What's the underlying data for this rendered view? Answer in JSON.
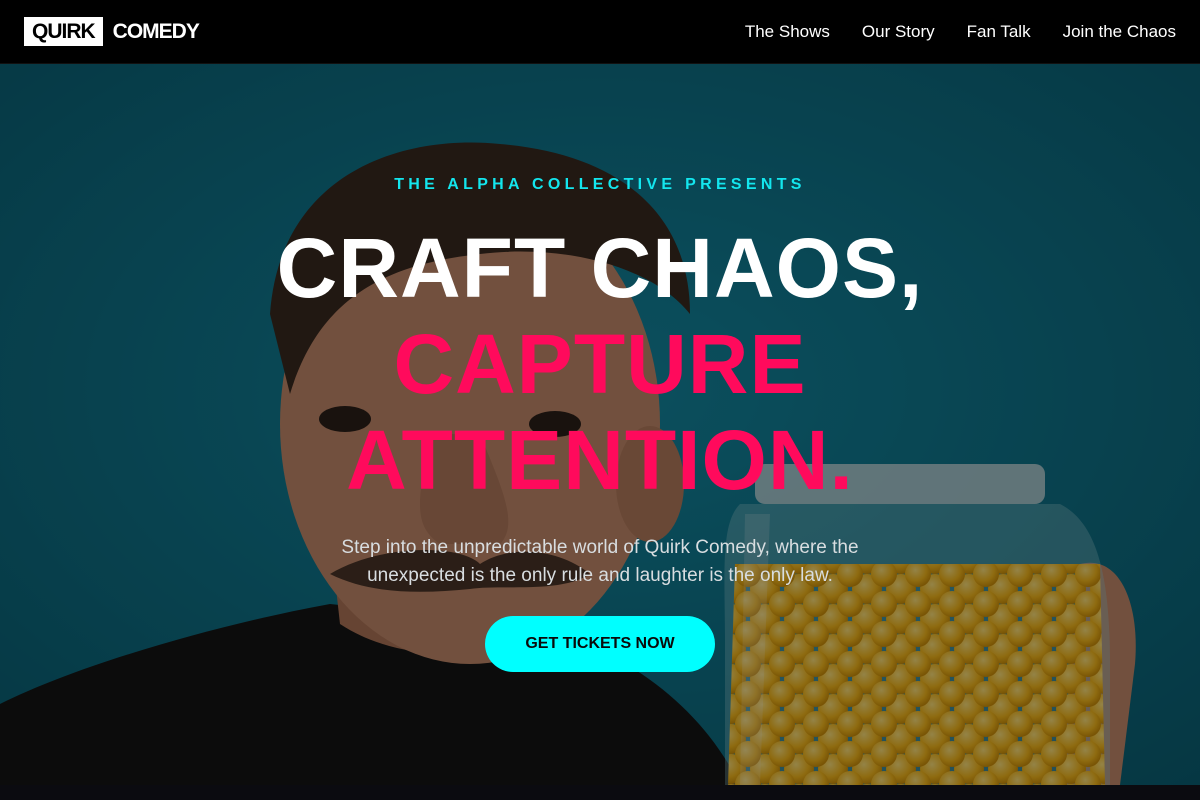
{
  "nav": {
    "logo_boxed": "QUIRK",
    "logo_word": "COMEDY",
    "links": [
      "The Shows",
      "Our Story",
      "Fan Talk",
      "Join the Chaos"
    ]
  },
  "hero": {
    "eyebrow": "THE ALPHA COLLECTIVE PRESENTS",
    "headline_line1": "CRAFT CHAOS,",
    "headline_line2": "CAPTURE",
    "headline_line3": "ATTENTION.",
    "subtitle": "Step into the unpredictable world of Quirk Comedy, where the unexpected is the only rule and laughter is the only law.",
    "cta_label": "GET TICKETS NOW",
    "background_image": "man-with-jar-of-cheese-balls-photo"
  },
  "colors": {
    "accent_cyan": "#00ffff",
    "accent_pink": "#ff0a5c",
    "nav_bg": "#000000",
    "hero_bg": "#0e6f85"
  }
}
